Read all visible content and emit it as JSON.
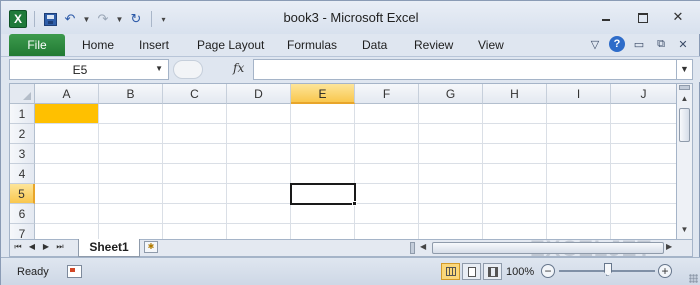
{
  "window": {
    "title": "book3 - Microsoft Excel",
    "logo_letter": "X"
  },
  "ribbon": {
    "file_label": "File",
    "tabs": [
      "Home",
      "Insert",
      "Page Layout",
      "Formulas",
      "Data",
      "Review",
      "View"
    ],
    "help_label": "?"
  },
  "formula_bar": {
    "name_box": "E5",
    "fx_label": "fx",
    "formula_value": ""
  },
  "grid": {
    "columns": [
      "A",
      "B",
      "C",
      "D",
      "E",
      "F",
      "G",
      "H",
      "I",
      "J"
    ],
    "rows": [
      "1",
      "2",
      "3",
      "4",
      "5",
      "6",
      "7"
    ],
    "active_cell": "E5",
    "filled_cell": "A1",
    "fill_color": "#ffc000",
    "header_highlight_color": "#f9c74e"
  },
  "sheets": {
    "tabs": [
      "Sheet1"
    ],
    "active": "Sheet1"
  },
  "status_bar": {
    "mode": "Ready",
    "zoom": "100%",
    "zoom_minus": "−",
    "zoom_plus": "+"
  },
  "watermark": "EXCELJET"
}
